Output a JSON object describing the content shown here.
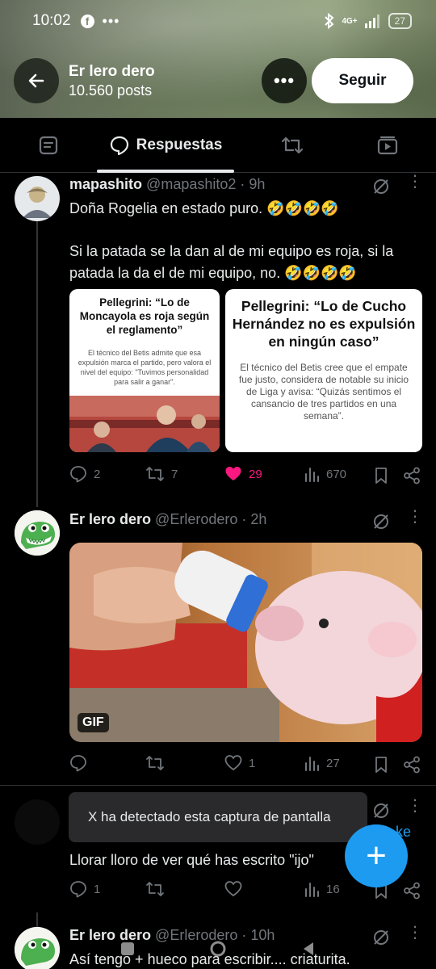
{
  "status_bar": {
    "time": "10:02",
    "fb_letter": "f",
    "dots": "•••",
    "network": "4G+",
    "battery": "27"
  },
  "profile_header": {
    "name": "Er lero dero",
    "posts": "10.560 posts",
    "follow_label": "Seguir",
    "more_label": "•••"
  },
  "tabs": {
    "replies_label": "Respuestas"
  },
  "tweets": [
    {
      "name": "mapashito",
      "handle": "@mapashito2 · 9h",
      "text1": "Doña Rogelia en estado puro. 🤣🤣🤣🤣",
      "text2": "Si la patada se la dan al de mi equipo es roja, si la patada la da el de mi equipo, no. 🤣🤣🤣🤣",
      "card_left": {
        "title": "Pellegrini: “Lo de Moncayola es roja según el reglamento”",
        "body": "El técnico del Betis admite que esa expulsión marca el partido, pero valora el nivel del equipo: \"Tuvimos personalidad para salir a ganar\"."
      },
      "card_right": {
        "title": "Pellegrini: “Lo de Cucho Hernández no es expulsión en ningún caso”",
        "body": "El técnico del Betis cree que el empate fue justo, considera de notable su inicio de Liga y avisa: “Quizás sentimos el cansancio de tres partidos en una semana”."
      },
      "replies": "2",
      "reposts": "7",
      "likes": "29",
      "views": "670"
    },
    {
      "name": "Er lero dero",
      "handle": "@Erlerodero · 2h",
      "gif_label": "GIF",
      "replies": "",
      "reposts": "",
      "likes": "1",
      "views": "27"
    },
    {
      "handle_partial": "ke",
      "text": "Llorar lloro de ver qué has escrito \"ijo\"",
      "replies": "1",
      "reposts": "",
      "likes": "",
      "views": "16"
    },
    {
      "name": "Er lero dero",
      "handle": "@Erlerodero · 10h",
      "text": "Así tengo + hueco para escribir.... criaturita."
    }
  ],
  "toast": {
    "text": "X ha detectado esta captura de pantalla"
  },
  "fab": {
    "label": "+"
  },
  "colors": {
    "accent": "#1d9bf0",
    "like": "#f91880",
    "muted": "#71767b",
    "text": "#e7e9ea"
  }
}
